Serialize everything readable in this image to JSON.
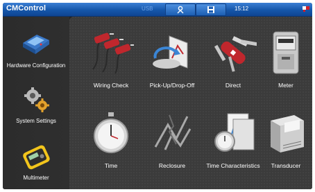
{
  "titlebar": {
    "app_title": "CMControl",
    "usb_label": "USB",
    "clock": "15:12"
  },
  "sidebar": {
    "items": [
      {
        "label": "Hardware Configuration",
        "icon": "hardware-device-icon"
      },
      {
        "label": "System Settings",
        "icon": "gears-icon"
      },
      {
        "label": "Multimeter",
        "icon": "multimeter-icon"
      }
    ]
  },
  "tiles": [
    {
      "label": "Wiring Check",
      "icon": "cable-plugs-icon"
    },
    {
      "label": "Pick-Up/Drop-Off",
      "icon": "pickup-dropoff-icon"
    },
    {
      "label": "Direct",
      "icon": "multi-tool-knife-icon"
    },
    {
      "label": "Meter",
      "icon": "energy-meter-icon"
    },
    {
      "label": "Time",
      "icon": "stopwatch-icon"
    },
    {
      "label": "Reclosure",
      "icon": "reclosure-icon"
    },
    {
      "label": "Time Characteristics",
      "icon": "time-characteristics-icon"
    },
    {
      "label": "Transducer",
      "icon": "transducer-icon"
    }
  ],
  "colors": {
    "titlebar": "#1556aa",
    "sidebar": "#2c2c2c",
    "main": "#3b3b3b",
    "label_text": "#ffffff",
    "accent_red": "#c0272d"
  }
}
